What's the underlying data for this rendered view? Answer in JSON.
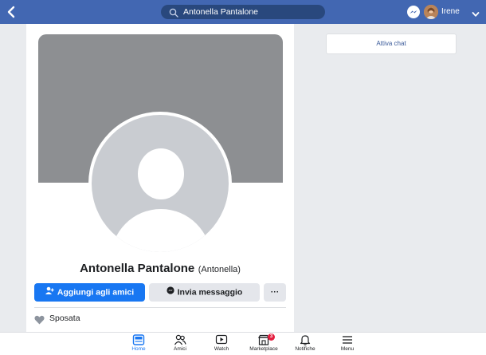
{
  "topbar": {
    "search_value": "Antonella Pantalone",
    "user_name": "Irene",
    "back_icon": "chevron-left-icon",
    "search_icon": "search-icon",
    "messenger_icon": "messenger-icon",
    "dropdown_icon": "chevron-down-icon",
    "bar_color": "#4267b2"
  },
  "profile": {
    "name": "Antonella Pantalone",
    "alternate_name": "(Antonella)",
    "add_friend_label": "Aggiungi agli amici",
    "message_label": "Invia messaggio",
    "more_label": "···",
    "relationship_status": "Sposata",
    "primary_button_color": "#1877f2"
  },
  "sidebar": {
    "chat_label": "Attiva chat"
  },
  "bottom_nav": {
    "items": [
      {
        "label": "Home",
        "icon": "home-icon",
        "active": true
      },
      {
        "label": "Amici",
        "icon": "friends-icon",
        "active": false
      },
      {
        "label": "Watch",
        "icon": "watch-icon",
        "active": false
      },
      {
        "label": "Marketplace",
        "icon": "marketplace-icon",
        "active": false,
        "badge": "3"
      },
      {
        "label": "Notifiche",
        "icon": "bell-icon",
        "active": false
      },
      {
        "label": "Menu",
        "icon": "menu-icon",
        "active": false
      }
    ]
  }
}
